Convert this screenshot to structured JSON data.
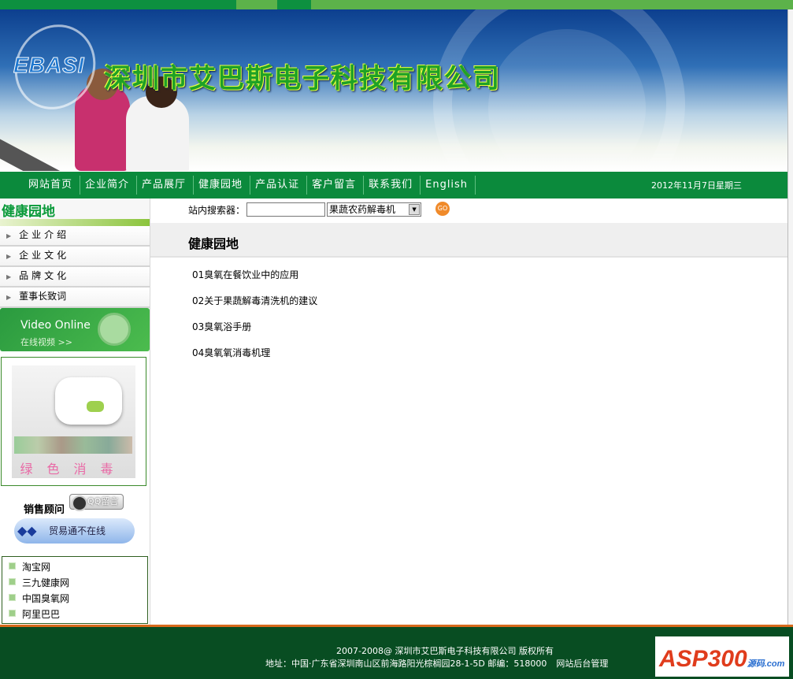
{
  "header": {
    "logo_text": "EBASI",
    "company_name": "深圳市艾巴斯电子科技有限公司"
  },
  "nav": {
    "items": [
      "网站首页",
      "企业简介",
      "产品展厅",
      "健康园地",
      "产品认证",
      "客户留言",
      "联系我们",
      "English"
    ],
    "date": "2012年11月7日星期三"
  },
  "sidebar": {
    "title": "健康园地",
    "menu": [
      "企业介绍",
      "企业文化",
      "品牌文化",
      "董事长致词"
    ],
    "video": {
      "title": "Video Online",
      "subtitle": "在线视频 >>"
    },
    "product_caption": "绿色消毒",
    "sales": {
      "label": "销售顾问",
      "qq_button": "QQ留言",
      "trade_status": "贸易通不在线"
    },
    "links": [
      "淘宝网",
      "三九健康网",
      "中国臭氧网",
      "阿里巴巴"
    ]
  },
  "search": {
    "label": "站内搜索器：",
    "value": "",
    "category": "果蔬农药解毒机",
    "go": "GO"
  },
  "main": {
    "title": "健康园地",
    "articles": [
      "01臭氧在餐饮业中的应用",
      "02关于果蔬解毒清洗机的建议",
      "03臭氧浴手册",
      "04臭氧氧消毒机理"
    ]
  },
  "footer": {
    "copyright": "2007-2008@ 深圳市艾巴斯电子科技有限公司 版权所有",
    "address": "地址：中国·广东省深圳南山区前海路阳光棕榈园28-1-5D 邮编：518000",
    "admin_link": "网站后台管理",
    "badge": "ASP300",
    "badge_suffix": "源码.com"
  }
}
